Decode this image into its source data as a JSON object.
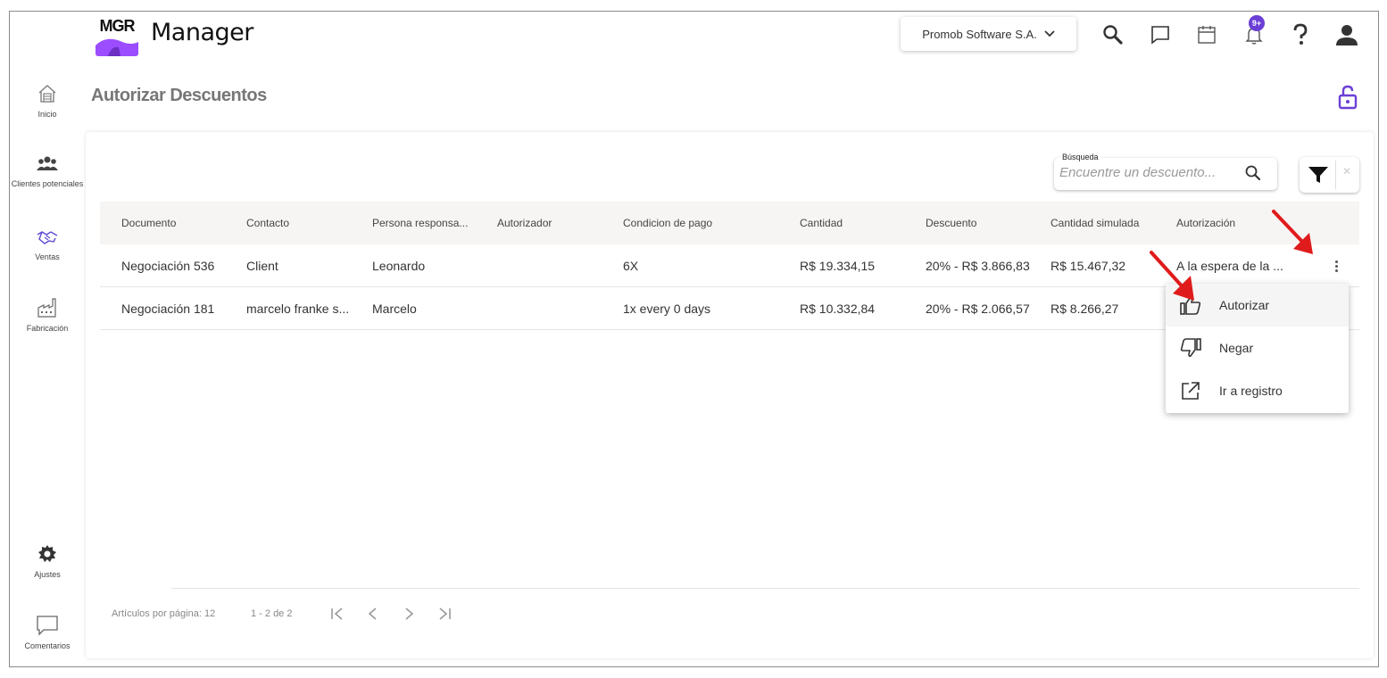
{
  "app": {
    "logo": "MGR",
    "name": "Manager"
  },
  "sidebar": {
    "items": [
      {
        "label": "Inicio",
        "icon": "home-icon"
      },
      {
        "label": "Clientes potenciales",
        "icon": "people-icon"
      },
      {
        "label": "Ventas",
        "icon": "handshake-icon"
      },
      {
        "label": "Fabricación",
        "icon": "factory-icon"
      },
      {
        "label": "Ajustes",
        "icon": "gear-icon"
      },
      {
        "label": "Comentarios",
        "icon": "comment-icon"
      }
    ]
  },
  "header": {
    "company": "Promob Software S.A.",
    "notification_badge": "9+",
    "accent_color": "#6b3fd6"
  },
  "page": {
    "title": "Autorizar Descuentos"
  },
  "search": {
    "label": "Búsqueda",
    "placeholder": "Encuentre un descuento..."
  },
  "table": {
    "columns": [
      "Documento",
      "Contacto",
      "Persona responsa...",
      "Autorizador",
      "Condicion de pago",
      "Cantidad",
      "Descuento",
      "Cantidad simulada",
      "Autorización"
    ],
    "rows": [
      {
        "documento": "Negociación 536",
        "contacto": "Client",
        "persona": "Leonardo",
        "autorizador": "",
        "condicion": "6X",
        "cantidad": "R$ 19.334,15",
        "descuento": "20% - R$ 3.866,83",
        "simulada": "R$ 15.467,32",
        "autorizacion": "A la espera de la ..."
      },
      {
        "documento": "Negociación 181",
        "contacto": "marcelo franke s...",
        "persona": "Marcelo",
        "autorizador": "",
        "condicion": "1x every 0 days",
        "cantidad": "R$ 10.332,84",
        "descuento": "20% - R$ 2.066,57",
        "simulada": "R$ 8.266,27",
        "autorizacion": ""
      }
    ]
  },
  "pagination": {
    "per_page_label": "Artículos por página: 12",
    "range": "1 - 2 de 2"
  },
  "menu": {
    "items": [
      {
        "label": "Autorizar",
        "icon": "thumbs-up-icon"
      },
      {
        "label": "Negar",
        "icon": "thumbs-down-icon"
      },
      {
        "label": "Ir a registro",
        "icon": "open-external-icon"
      }
    ]
  }
}
